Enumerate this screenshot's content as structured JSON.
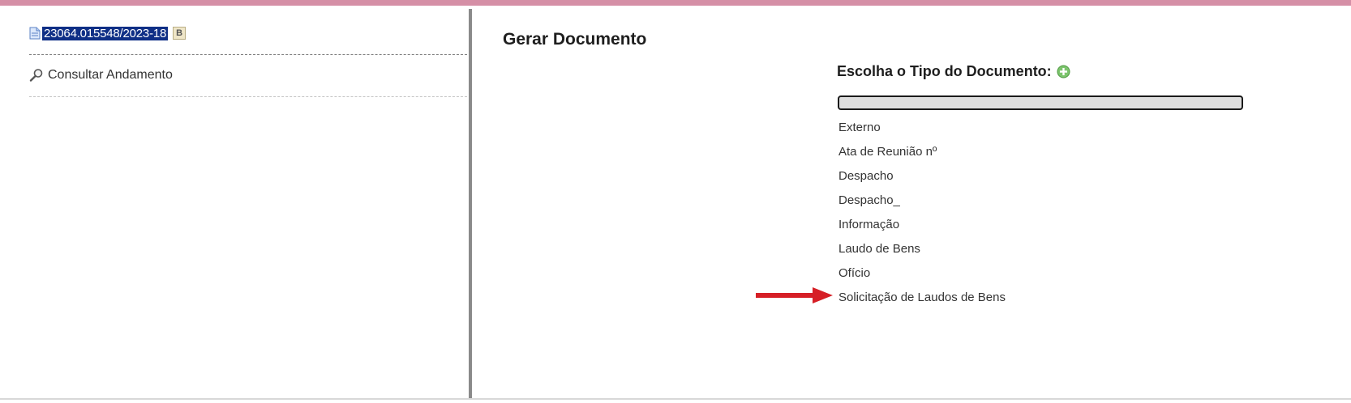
{
  "left_panel": {
    "process_number": "23064.015548/2023-18",
    "badge_letter": "B",
    "consult_link": "Consultar Andamento",
    "icons": {
      "document": "document-icon",
      "consult": "magnifier-icon"
    }
  },
  "main": {
    "title": "Gerar Documento",
    "choose_label": "Escolha o Tipo do Documento:",
    "add_icon": "plus-circle-icon",
    "filter": {
      "value": "",
      "placeholder": ""
    },
    "document_types": [
      "Externo",
      "Ata de Reunião nº",
      "Despacho",
      "Despacho_",
      "Informação",
      "Laudo de Bens",
      "Ofício",
      "Solicitação de Laudos de Bens"
    ],
    "highlighted_index": 7
  },
  "colors": {
    "top_bar": "#d58fa6",
    "process_highlight": "#0f2f86",
    "arrow": "#d61f26"
  }
}
